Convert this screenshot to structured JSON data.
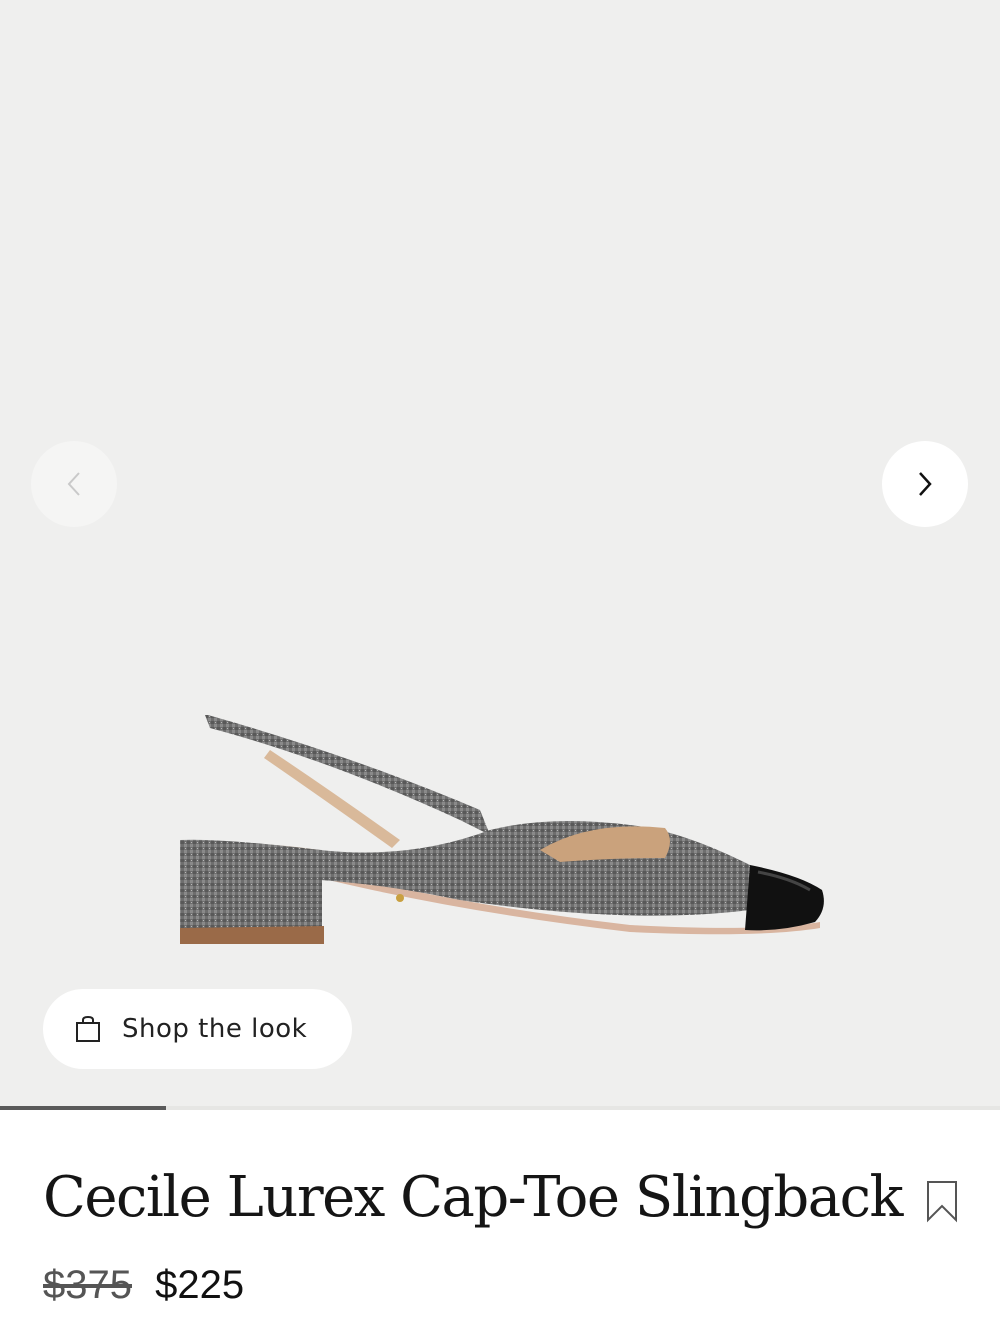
{
  "product": {
    "title": "Cecile Lurex Cap-Toe Slingback",
    "original_price": "$375",
    "sale_price": "$225"
  },
  "gallery": {
    "shop_the_look_label": "Shop the look",
    "progress": 0.166
  },
  "icons": {
    "prev": "chevron-left-icon",
    "next": "chevron-right-icon",
    "shop": "shopping-bag-icon",
    "bookmark": "bookmark-icon"
  },
  "colors": {
    "gallery_bg": "#efefee",
    "progress": "#5a5a5a"
  }
}
